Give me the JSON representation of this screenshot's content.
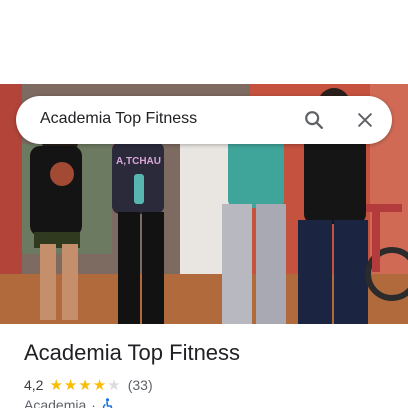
{
  "search": {
    "query": "Academia Top Fitness",
    "search_icon": "search-icon",
    "close_icon": "close-icon"
  },
  "photo": {
    "shirt_text": "A,TCHAU"
  },
  "place": {
    "name": "Academia Top Fitness",
    "rating": "4,2",
    "stars_filled": 4,
    "stars_total": 5,
    "review_count": "(33)",
    "category": "Academia",
    "separator": "·",
    "accessibility_icon": "wheelchair-icon"
  },
  "colors": {
    "star_filled": "#fbbc04",
    "star_empty": "#dadce0",
    "accessibility_blue": "#1a73e8"
  }
}
